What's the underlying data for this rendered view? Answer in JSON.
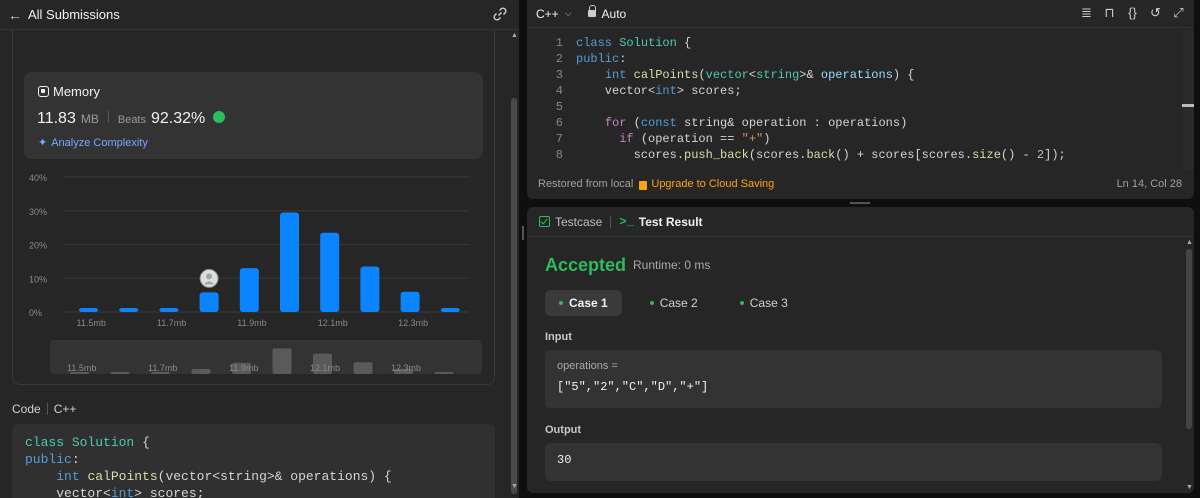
{
  "left_header": {
    "back_label": "All Submissions"
  },
  "memory": {
    "title": "Memory",
    "value": "11.83",
    "unit": "MB",
    "beats_label": "Beats",
    "beats_pct": "92.32%",
    "analyze_label": "Analyze Complexity"
  },
  "chart_data": {
    "type": "bar",
    "yticks": [
      "40%",
      "30%",
      "20%",
      "10%",
      "0%"
    ],
    "xticks": [
      "11.5mb",
      "11.7mb",
      "11.9mb",
      "12.1mb",
      "12.3mb"
    ],
    "values": [
      1.2,
      1.2,
      1.2,
      5.8,
      13.0,
      29.5,
      23.5,
      13.5,
      6.0,
      1.2
    ],
    "ylim": [
      0,
      40
    ],
    "user_bar_index": 3,
    "bar_color": "#0a84ff"
  },
  "minimap": {
    "labels": [
      "11.5mb",
      "11.7mb",
      "11.9mb",
      "12.1mb",
      "12.3mb"
    ]
  },
  "code_section": {
    "label": "Code",
    "language": "C++",
    "lines": [
      "class Solution {",
      "public:",
      "    int calPoints(vector<string>& operations) {",
      "    vector<int> scores;"
    ]
  },
  "editor": {
    "language": "C++",
    "mode": "Auto",
    "footer_restored": "Restored from local",
    "footer_upgrade": "Upgrade to Cloud Saving",
    "cursor_pos": "Ln 14, Col 28",
    "line_numbers": [
      "1",
      "2",
      "3",
      "4",
      "5",
      "6",
      "7",
      "8"
    ]
  },
  "result": {
    "tab_testcase": "Testcase",
    "tab_result": "Test Result",
    "status": "Accepted",
    "runtime": "Runtime: 0 ms",
    "cases": [
      "Case 1",
      "Case 2",
      "Case 3"
    ],
    "input_label": "Input",
    "input_name": "operations =",
    "input_value": "[\"5\",\"2\",\"C\",\"D\",\"+\"]",
    "output_label": "Output",
    "output_value": "30"
  },
  "colors": {
    "accent_green": "#2cbb5d",
    "accent_orange": "#ffa116",
    "bar_blue": "#0a84ff"
  }
}
